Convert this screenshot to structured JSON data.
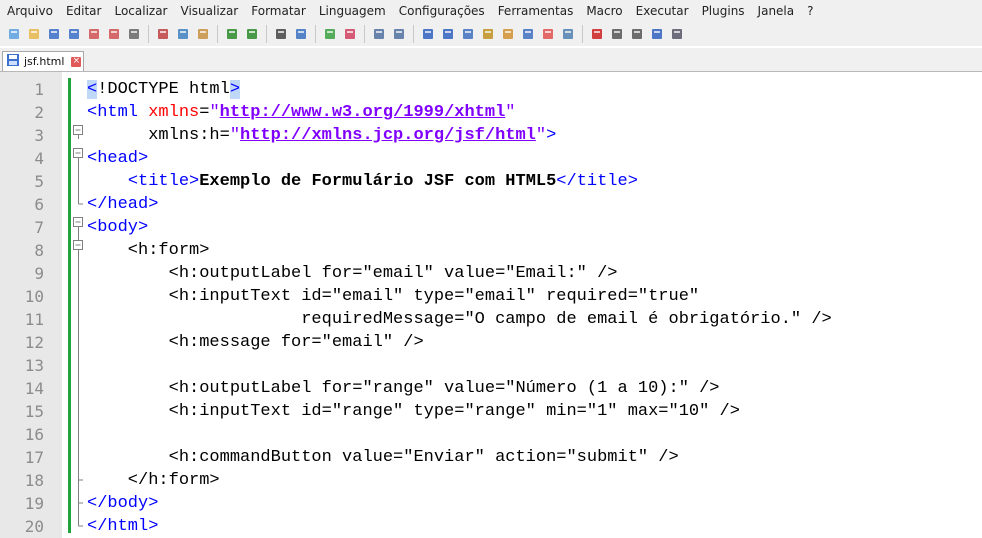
{
  "menu": [
    "Arquivo",
    "Editar",
    "Localizar",
    "Visualizar",
    "Formatar",
    "Linguagem",
    "Configurações",
    "Ferramentas",
    "Macro",
    "Executar",
    "Plugins",
    "Janela",
    "?"
  ],
  "toolbar_icons": [
    "new-file-icon",
    "open-file-icon",
    "save-icon",
    "save-all-icon",
    "close-icon",
    "close-all-icon",
    "print-icon",
    "cut-icon",
    "copy-icon",
    "paste-icon",
    "undo-icon",
    "redo-icon",
    "find-icon",
    "replace-icon",
    "zoom-in-icon",
    "zoom-out-icon",
    "sync-vertical-icon",
    "sync-horizontal-icon",
    "word-wrap-icon",
    "show-all-chars-icon",
    "indent-guide-icon",
    "udl-icon",
    "doc-map-icon",
    "function-list-icon",
    "folder-workspace-icon",
    "monitor-icon",
    "record-macro-icon",
    "stop-macro-icon",
    "play-macro-icon",
    "run-macro-multiple-icon",
    "save-macro-icon"
  ],
  "tab": {
    "label": "jsf.html"
  },
  "lines": [
    {
      "n": "1",
      "parts": [
        [
          "t hl",
          "<"
        ],
        [
          "k",
          "!DOCTYPE html"
        ],
        [
          "t hl",
          ">"
        ]
      ]
    },
    {
      "n": "2",
      "parts": [
        [
          "t",
          "<html "
        ],
        [
          "a",
          "xmlns"
        ],
        [
          "k",
          "="
        ],
        [
          "v",
          "\""
        ],
        [
          "u",
          "http://www.w3.org/1999/xhtml"
        ],
        [
          "v",
          "\""
        ]
      ]
    },
    {
      "n": "3",
      "parts": [
        [
          "k",
          "      xmlns:h="
        ],
        [
          "v",
          "\""
        ],
        [
          "u",
          "http://xmlns.jcp.org/jsf/html"
        ],
        [
          "v",
          "\""
        ],
        [
          "t",
          ">"
        ]
      ]
    },
    {
      "n": "4",
      "parts": [
        [
          "t",
          "<head>"
        ]
      ]
    },
    {
      "n": "5",
      "parts": [
        [
          "k",
          "    "
        ],
        [
          "t",
          "<title>"
        ],
        [
          "b",
          "Exemplo de Formulário JSF com HTML5"
        ],
        [
          "t",
          "</title>"
        ]
      ]
    },
    {
      "n": "6",
      "parts": [
        [
          "t",
          "</head>"
        ]
      ]
    },
    {
      "n": "7",
      "parts": [
        [
          "t",
          "<body>"
        ]
      ]
    },
    {
      "n": "8",
      "parts": [
        [
          "k",
          "    <h:form>"
        ]
      ]
    },
    {
      "n": "9",
      "parts": [
        [
          "k",
          "        <h:outputLabel for=\"email\" value=\"Email:\" />"
        ]
      ]
    },
    {
      "n": "10",
      "parts": [
        [
          "k",
          "        <h:inputText id=\"email\" type=\"email\" required=\"true\""
        ]
      ]
    },
    {
      "n": "11",
      "parts": [
        [
          "k",
          "                     requiredMessage=\"O campo de email é obrigatório.\" />"
        ]
      ]
    },
    {
      "n": "12",
      "parts": [
        [
          "k",
          "        <h:message for=\"email\" />"
        ]
      ]
    },
    {
      "n": "13",
      "parts": [
        [
          "k",
          ""
        ]
      ]
    },
    {
      "n": "14",
      "parts": [
        [
          "k",
          "        <h:outputLabel for=\"range\" value=\"Número (1 a 10):\" />"
        ]
      ]
    },
    {
      "n": "15",
      "parts": [
        [
          "k",
          "        <h:inputText id=\"range\" type=\"range\" min=\"1\" max=\"10\" />"
        ]
      ]
    },
    {
      "n": "16",
      "parts": [
        [
          "k",
          ""
        ]
      ]
    },
    {
      "n": "17",
      "parts": [
        [
          "k",
          "        <h:commandButton value=\"Enviar\" action=\"submit\" />"
        ]
      ]
    },
    {
      "n": "18",
      "parts": [
        [
          "k",
          "    </h:form>"
        ]
      ]
    },
    {
      "n": "19",
      "parts": [
        [
          "t",
          "</body>"
        ]
      ]
    },
    {
      "n": "20",
      "parts": [
        [
          "t",
          "</html>"
        ]
      ]
    }
  ]
}
